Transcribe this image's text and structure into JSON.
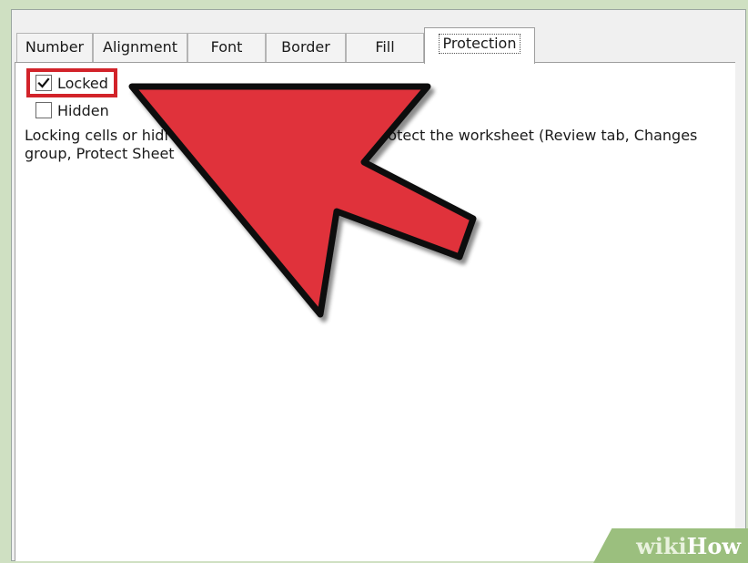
{
  "tabs": [
    {
      "label": "Number"
    },
    {
      "label": "Alignment"
    },
    {
      "label": "Font"
    },
    {
      "label": "Border"
    },
    {
      "label": "Fill"
    },
    {
      "label": "Protection",
      "active": true
    }
  ],
  "protection": {
    "locked": {
      "label": "Locked",
      "checked": true
    },
    "hidden": {
      "label": "Hidden",
      "checked": false
    },
    "description_line1": "Locking cells or hidi",
    "description_line1b": "ou protect the worksheet (Review tab, Changes",
    "description_line2": "group, Protect Sheet"
  },
  "overlay": {
    "arrow_color": "#e0303b",
    "highlight_color": "#d2232a",
    "watermark": {
      "wiki": "wiki",
      "how": "How"
    }
  }
}
